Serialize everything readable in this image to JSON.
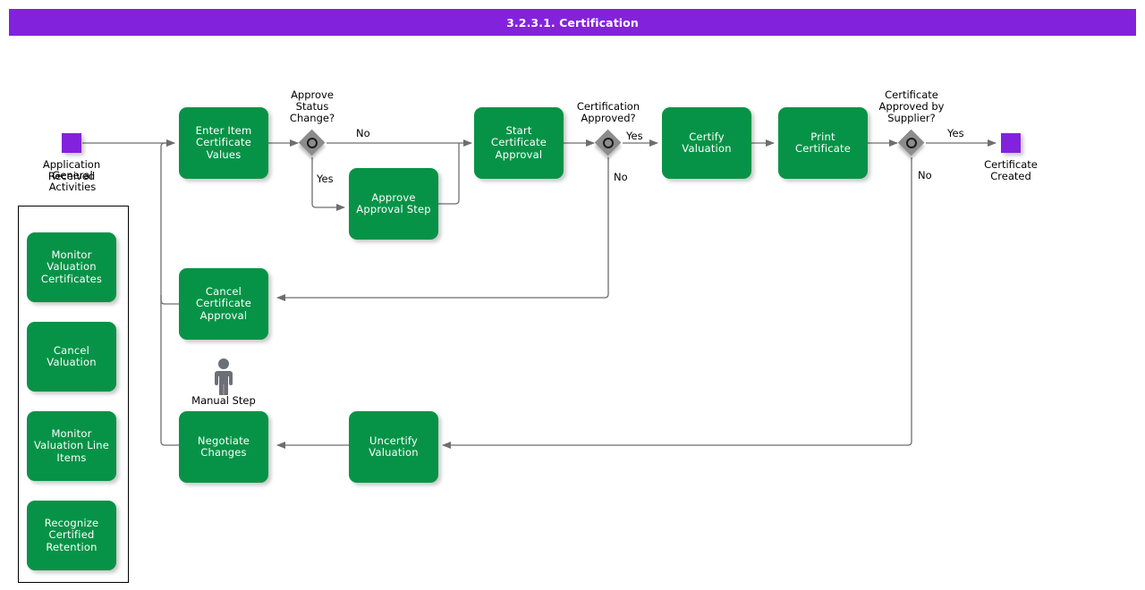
{
  "header": {
    "title": "3.2.3.1. Certification"
  },
  "colors": {
    "header_bg": "#8322dc",
    "task_fill": "#079347",
    "task_text": "#ffffff",
    "event_fill": "#8322dc",
    "gateway_fill": "#8c8c8c",
    "connector": "#6e6e6e",
    "group_border": "#000000",
    "manual_icon": "#6b7076"
  },
  "diagram": {
    "type": "flowchart",
    "events": [
      {
        "id": "start",
        "name": "application-received",
        "label": "Application\nReceived",
        "kind": "start-event"
      },
      {
        "id": "end",
        "name": "certificate-created",
        "label": "Certificate\nCreated",
        "kind": "end-event"
      }
    ],
    "tasks": [
      {
        "id": "enter_item",
        "name": "enter-item-certificate-values",
        "label": "Enter Item\nCertificate\nValues"
      },
      {
        "id": "approve_step",
        "name": "approve-approval-step",
        "label": "Approve\nApproval Step"
      },
      {
        "id": "start_cert",
        "name": "start-certificate-approval",
        "label": "Start Certificate\nApproval"
      },
      {
        "id": "certify",
        "name": "certify-valuation",
        "label": "Certify Valuation"
      },
      {
        "id": "print",
        "name": "print-certificate",
        "label": "Print Certificate"
      },
      {
        "id": "cancel_cert",
        "name": "cancel-certificate-approval",
        "label": "Cancel\nCertificate\nApproval"
      },
      {
        "id": "negotiate",
        "name": "negotiate-changes",
        "label": "Negotiate\nChanges"
      },
      {
        "id": "uncertify",
        "name": "uncertify-valuation",
        "label": "Uncertify\nValuation"
      }
    ],
    "gateways": [
      {
        "id": "gw1",
        "name": "approve-status-change",
        "label": "Approve\nStatus\nChange?"
      },
      {
        "id": "gw2",
        "name": "certification-approved",
        "label": "Certification\nApproved?"
      },
      {
        "id": "gw3",
        "name": "certificate-approved-by-supplier",
        "label": "Certificate\nApproved by\nSupplier?"
      }
    ],
    "flow_labels": [
      {
        "id": "gw1_no",
        "name": "flow-label-gw1-no",
        "text": "No"
      },
      {
        "id": "gw1_yes",
        "name": "flow-label-gw1-yes",
        "text": "Yes"
      },
      {
        "id": "gw2_yes",
        "name": "flow-label-gw2-yes",
        "text": "Yes"
      },
      {
        "id": "gw2_no",
        "name": "flow-label-gw2-no",
        "text": "No"
      },
      {
        "id": "gw3_yes",
        "name": "flow-label-gw3-yes",
        "text": "Yes"
      },
      {
        "id": "gw3_no",
        "name": "flow-label-gw3-no",
        "text": "No"
      }
    ],
    "annotations": [
      {
        "id": "manual_step",
        "name": "manual-step-annotation",
        "text": "Manual Step"
      }
    ],
    "group": {
      "name": "general-activities-group",
      "title": "General\nActivities",
      "items": [
        {
          "id": "monitor_cert",
          "name": "monitor-valuation-certificates",
          "label": "Monitor\nValuation\nCertificates"
        },
        {
          "id": "cancel_val",
          "name": "cancel-valuation",
          "label": "Cancel Valuation"
        },
        {
          "id": "monitor_lines",
          "name": "monitor-valuation-line-items",
          "label": "Monitor\nValuation Line\nItems"
        },
        {
          "id": "recognize",
          "name": "recognize-certified-retention",
          "label": "Recognize\nCertified\nRetention"
        }
      ]
    }
  }
}
